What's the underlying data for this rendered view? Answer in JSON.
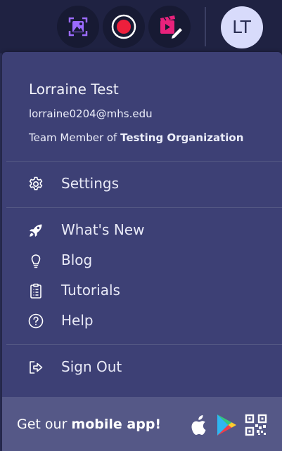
{
  "topbar": {
    "screenshot_icon": "image-capture-icon",
    "record_icon": "record-icon",
    "video_edit_icon": "video-edit-icon",
    "avatar_initials": "LT",
    "colors": {
      "accent_purple": "#9b6bff",
      "record_red": "#ee1f3c",
      "video_pink": "#e8227c"
    }
  },
  "user": {
    "name": "Lorraine Test",
    "email": "lorraine0204@mhs.edu",
    "team_prefix": "Team Member of ",
    "team_name": "Testing Organization"
  },
  "menu": {
    "settings": {
      "label": "Settings",
      "icon": "gear-icon"
    },
    "whats_new": {
      "label": "What's New",
      "icon": "rocket-icon"
    },
    "blog": {
      "label": "Blog",
      "icon": "lightbulb-icon"
    },
    "tutorials": {
      "label": "Tutorials",
      "icon": "clipboard-icon"
    },
    "help": {
      "label": "Help",
      "icon": "question-circle-icon"
    },
    "sign_out": {
      "label": "Sign Out",
      "icon": "sign-out-icon"
    }
  },
  "footer": {
    "text_prefix": "Get our ",
    "text_bold": "mobile app!",
    "icons": [
      "apple-icon",
      "google-play-icon",
      "qr-code-icon"
    ]
  }
}
